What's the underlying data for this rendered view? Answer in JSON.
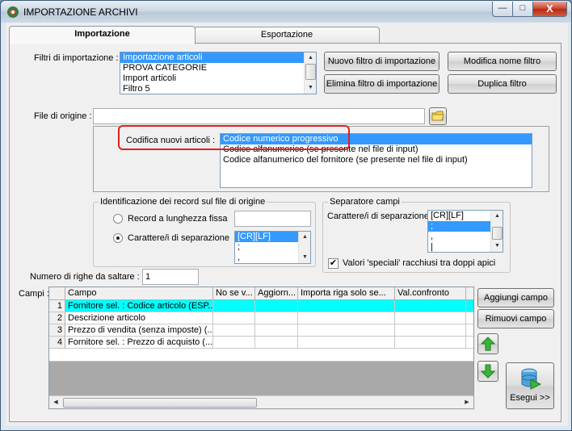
{
  "window": {
    "title": "IMPORTAZIONE ARCHIVI",
    "controls": {
      "minimize": "—",
      "maximize": "□",
      "close": "X"
    }
  },
  "tabs": [
    {
      "label": "Importazione",
      "active": true
    },
    {
      "label": "Esportazione",
      "active": false
    }
  ],
  "filters": {
    "label": "Filtri di importazione :",
    "items": [
      "Importazione articoli",
      "PROVA CATEGORIE",
      "Import articoli",
      "Filtro 5"
    ],
    "selected_index": 0
  },
  "buttons": {
    "new_filter": "Nuovo filtro di importazione",
    "rename_filter": "Modifica nome filtro",
    "delete_filter": "Elimina filtro di importazione",
    "duplicate_filter": "Duplica filtro",
    "add_field": "Aggiungi campo",
    "remove_field": "Rimuovi campo",
    "execute": "Esegui >>"
  },
  "source_file": {
    "label": "File di origine :",
    "value": ""
  },
  "new_codes": {
    "label": "Codifica nuovi articoli :",
    "items": [
      "Codice numerico progressivo",
      "Codice alfanumerico (se presente nel file di input)",
      "Codice alfanumerico del fornitore (se presente nel file di input)"
    ],
    "selected_index": 0
  },
  "record_id": {
    "title": "Identificazione dei record sul file di origine",
    "fixed_length_label": "Record a lunghezza fissa",
    "fixed_length_value": "",
    "separator_label": "Carattere/i di separazione",
    "separator_options": [
      "[CR][LF]",
      ";",
      ","
    ],
    "selected_option": "separator",
    "selected_separator_index": 0
  },
  "field_separator": {
    "title": "Separatore campi",
    "label": "Carattere/i di separazione",
    "options": [
      "[CR][LF]",
      ";",
      ",",
      "|"
    ],
    "selected_index": 1,
    "quoted_label": "Valori 'speciali' racchiusi tra doppi apici",
    "quoted_checked": true
  },
  "skip_rows": {
    "label": "Numero di righe da saltare :",
    "value": "1"
  },
  "fields_grid": {
    "label": "Campi :",
    "columns": [
      "Campo",
      "No se v...",
      "Aggiorn...",
      "Importa riga solo se...",
      "Val.confronto"
    ],
    "rows": [
      {
        "n": "1",
        "campo": "Fornitore sel. : Codice articolo (ESP...",
        "highlighted": true
      },
      {
        "n": "2",
        "campo": "Descrizione articolo",
        "highlighted": false
      },
      {
        "n": "3",
        "campo": "Prezzo di vendita (senza imposte) (...",
        "highlighted": false
      },
      {
        "n": "4",
        "campo": "Fornitore sel. : Prezzo di acquisto (...",
        "highlighted": false
      }
    ]
  },
  "colors": {
    "selection": "#3399ff",
    "row_highlight": "#00ffff",
    "annotation_ring": "#e02020",
    "arrow_green": "#2fa32f"
  }
}
